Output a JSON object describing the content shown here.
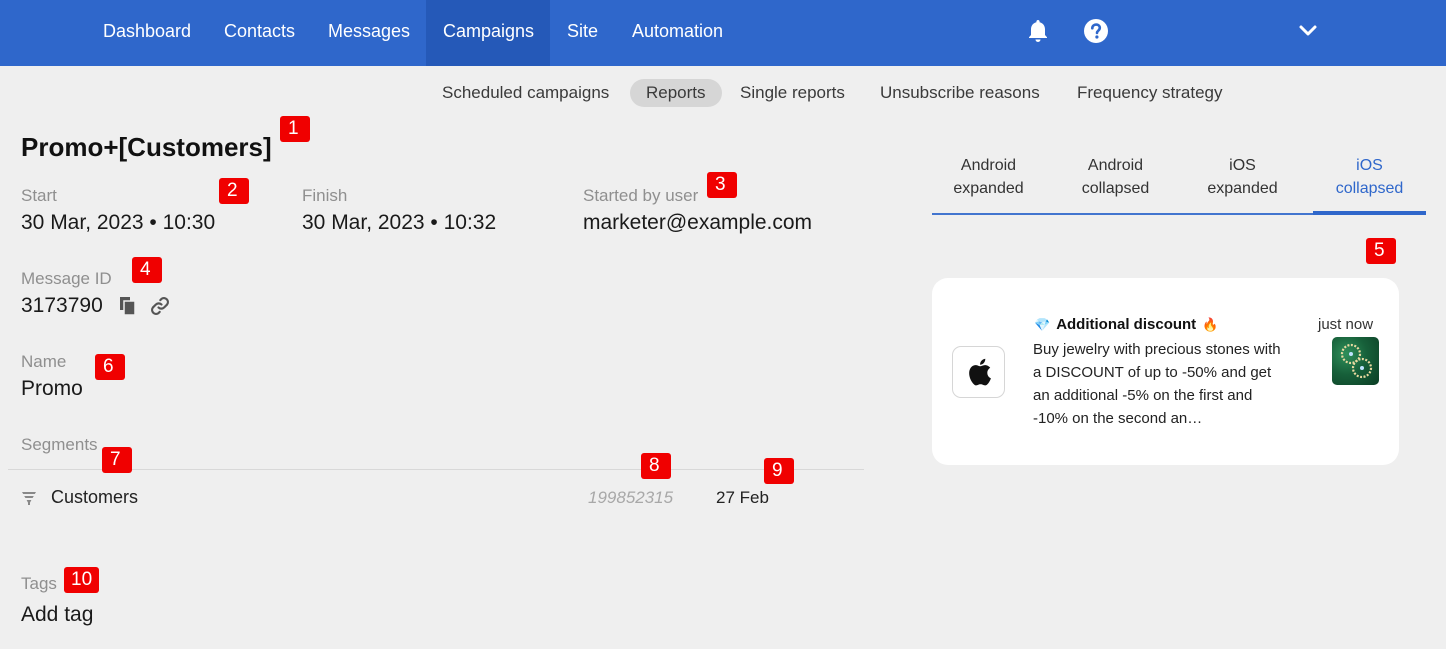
{
  "nav": {
    "items": [
      "Dashboard",
      "Contacts",
      "Messages",
      "Campaigns",
      "Site",
      "Automation"
    ],
    "active": "Campaigns",
    "icons": [
      "bell-icon",
      "help-icon",
      "chevron-down-icon"
    ]
  },
  "subnav": {
    "items": [
      "Scheduled campaigns",
      "Reports",
      "Single reports",
      "Unsubscribe reasons",
      "Frequency strategy"
    ],
    "active": "Reports"
  },
  "campaign": {
    "title": "Promo+[Customers]",
    "start_label": "Start",
    "start_value": "30 Mar, 2023 • 10:30",
    "finish_label": "Finish",
    "finish_value": "30 Mar, 2023 • 10:32",
    "started_by_label": "Started by user",
    "started_by_value": "marketer@example.com",
    "message_id_label": "Message ID",
    "message_id_value": "3173790",
    "name_label": "Name",
    "name_value": "Promo",
    "segments_label": "Segments",
    "segment": {
      "name": "Customers",
      "count": "199852315",
      "date": "27 Feb"
    },
    "tags_label": "Tags",
    "add_tag": "Add tag"
  },
  "preview": {
    "tabs": [
      {
        "line1": "Android",
        "line2": "expanded"
      },
      {
        "line1": "Android",
        "line2": "collapsed"
      },
      {
        "line1": "iOS",
        "line2": "expanded"
      },
      {
        "line1": "iOS",
        "line2": "collapsed"
      }
    ],
    "active_tab": 3,
    "notification": {
      "title_prefix": "💎",
      "title": "Additional discount",
      "title_suffix": "🔥",
      "body": "Buy jewelry with precious stones with a DISCOUNT of up to -50% and get an additional -5% on the first and -10% on the second an…",
      "time": "just now"
    }
  },
  "badges": [
    "1",
    "2",
    "3",
    "4",
    "5",
    "6",
    "7",
    "8",
    "9",
    "10"
  ],
  "colors": {
    "brand": "#2f67cb",
    "badge": "#f00000",
    "background": "#efefef"
  }
}
